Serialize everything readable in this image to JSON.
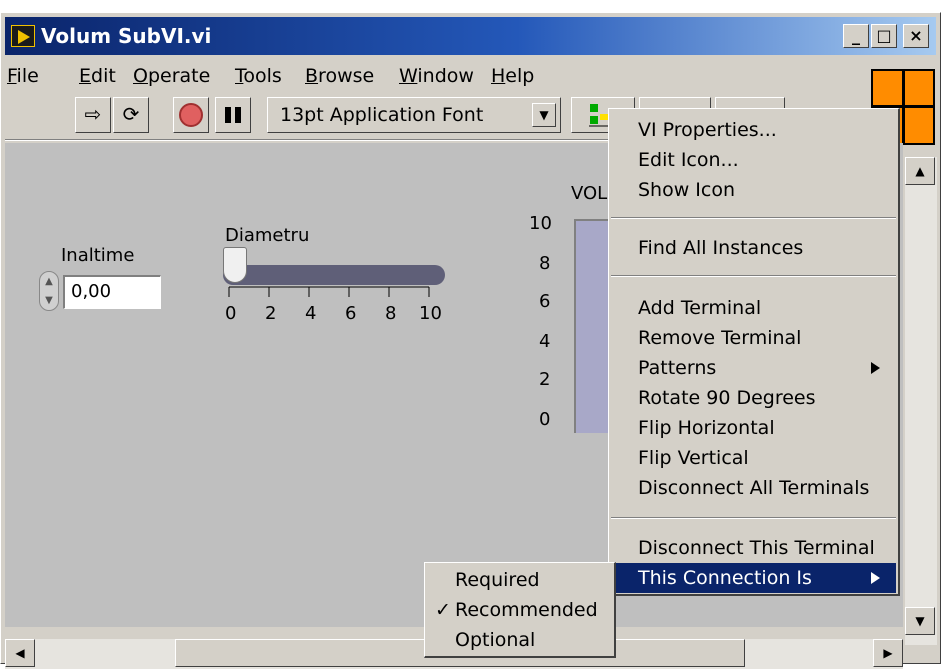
{
  "window": {
    "title": "Volum SubVI.vi",
    "controls": [
      "_",
      "□",
      "×"
    ]
  },
  "menubar": [
    "File",
    "Edit",
    "Operate",
    "Tools",
    "Browse",
    "Window",
    "Help"
  ],
  "toolbar": {
    "run_icon": "run-arrow-icon",
    "run_continuous_icon": "run-continuously-icon",
    "abort_icon": "abort-icon",
    "pause_icon": "pause-icon",
    "font": "13pt Application Font"
  },
  "panel": {
    "numeric": {
      "label": "Inaltime",
      "value": "0,00"
    },
    "slider": {
      "label": "Diametru",
      "ticks": [
        "0",
        "2",
        "4",
        "6",
        "8",
        "10"
      ],
      "value": 0
    },
    "tank": {
      "label": "VOL",
      "ticks": [
        "10",
        "8",
        "6",
        "4",
        "2",
        "0"
      ]
    }
  },
  "context_menu": {
    "items": [
      "VI Properties...",
      "Edit Icon...",
      "Show Icon",
      "Find All Instances",
      "Add Terminal",
      "Remove Terminal",
      "Patterns",
      "Rotate 90 Degrees",
      "Flip Horizontal",
      "Flip Vertical",
      "Disconnect All Terminals",
      "Disconnect This Terminal",
      "This Connection Is"
    ]
  },
  "submenu": {
    "items": [
      "Required",
      "Recommended",
      "Optional"
    ],
    "checked": "Recommended",
    "check_mark": "✓"
  },
  "colors": {
    "titlebar": "#0a246a",
    "highlight": "#0a246a",
    "vi_icon": "#ff8c00",
    "panel": "#bfbfbf"
  }
}
